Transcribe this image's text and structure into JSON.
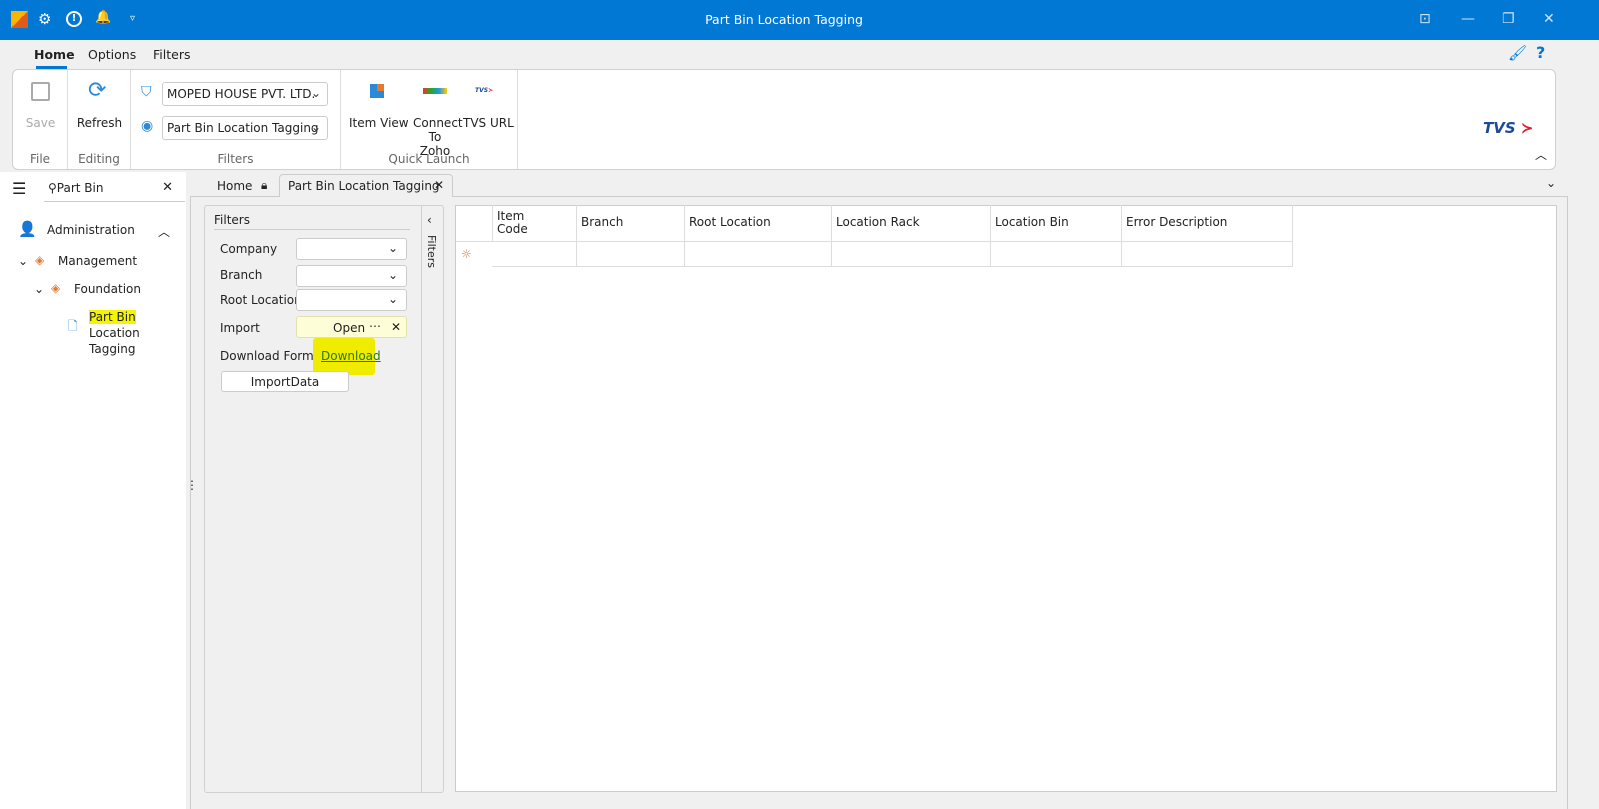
{
  "window": {
    "title": "Part Bin Location Tagging"
  },
  "ribbon": {
    "tabs": [
      "Home",
      "Options",
      "Filters"
    ],
    "file": {
      "save": "Save",
      "group": "File"
    },
    "editing": {
      "refresh": "Refresh",
      "group": "Editing"
    },
    "filters": {
      "company": "MOPED HOUSE PVT. LTD.",
      "view": "Part Bin Location Tagging",
      "group": "Filters"
    },
    "quick": {
      "item_view": "Item View",
      "zoho1": "Connect",
      "zoho2": "To Zoho",
      "tvs": "TVS URL",
      "group": "Quick Launch"
    },
    "logo": "TVS"
  },
  "sidebar": {
    "search": "Part Bin",
    "items": {
      "admin": "Administration",
      "management": "Management",
      "foundation": "Foundation",
      "leaf_hl": "Part Bin",
      "leaf_rest": " Location",
      "leaf2": "Tagging"
    }
  },
  "doctabs": {
    "home": "Home",
    "active": "Part Bin Location Tagging"
  },
  "filters": {
    "title": "Filters",
    "company": "Company",
    "branch": "Branch",
    "root": "Root Location",
    "import": "Import",
    "import_btn": "Open",
    "dl_label": "Download Format",
    "dl_link": "Download",
    "import_data": "ImportData",
    "side": "Filters"
  },
  "grid": {
    "columns": [
      "Item\nCode",
      "Branch",
      "Root Location",
      "Location Rack",
      "Location Bin",
      "Error Description"
    ]
  },
  "colors": {
    "accent": "#0078d4",
    "highlight": "#f5f500"
  }
}
